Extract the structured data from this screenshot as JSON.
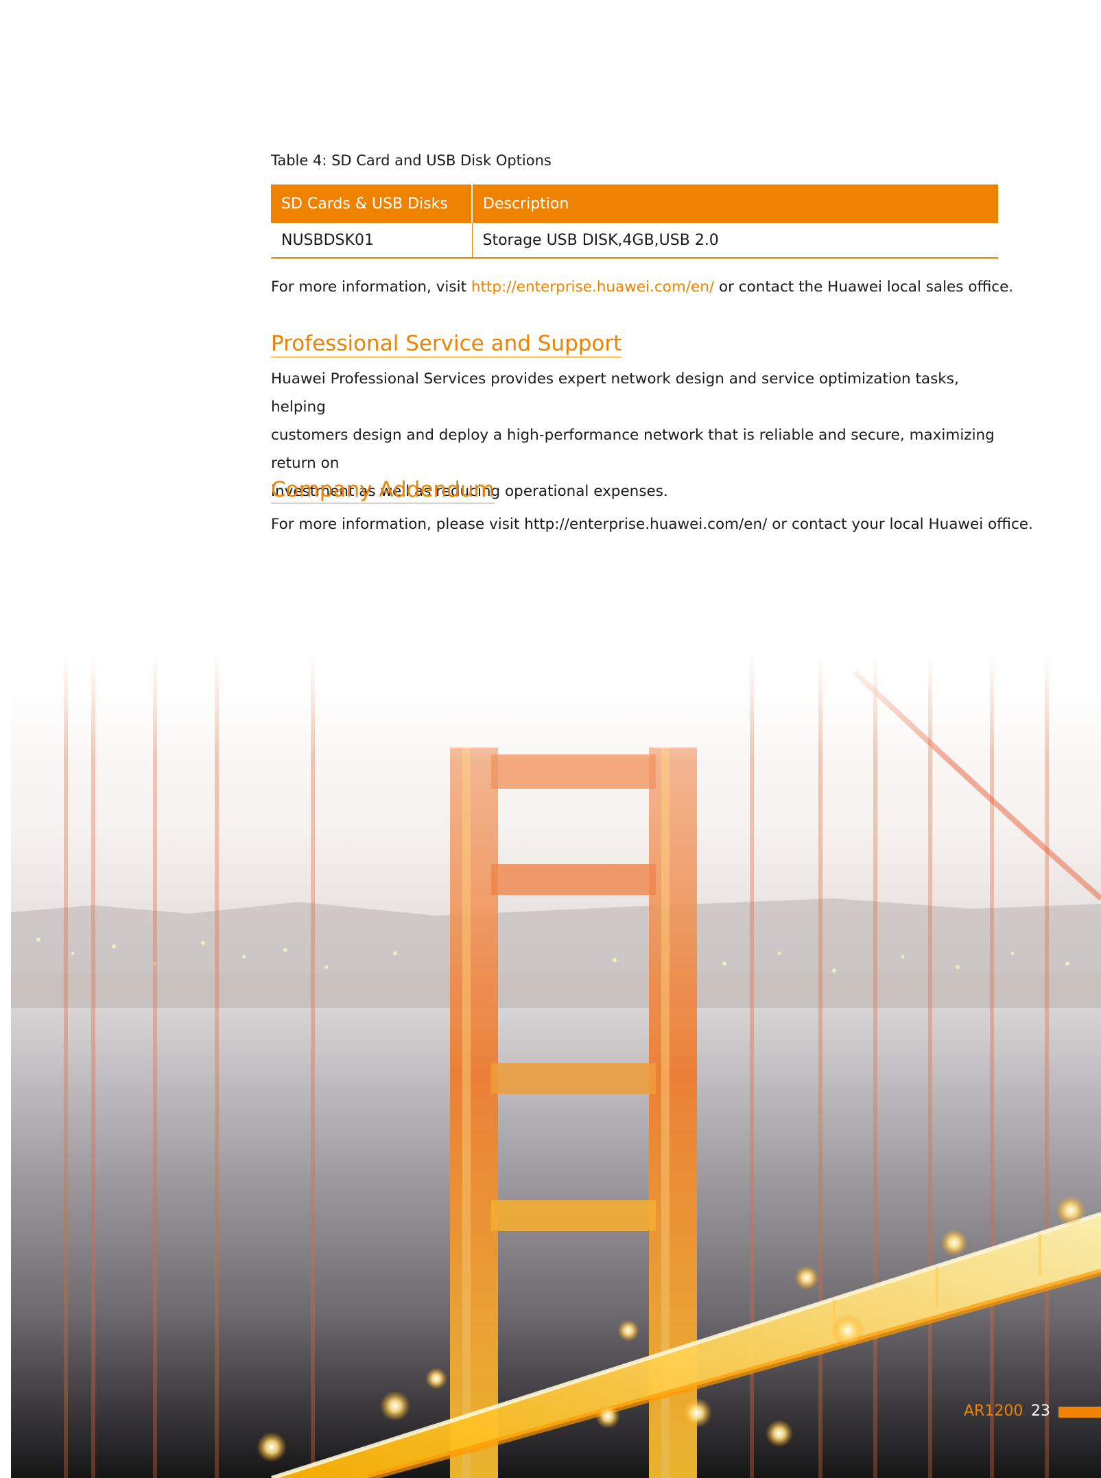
{
  "table": {
    "caption": "Table 4: SD Card and USB Disk Options",
    "headers": [
      "SD Cards & USB Disks",
      "Description"
    ],
    "rows": [
      [
        "NUSBDSK01",
        "Storage USB DISK,4GB,USB 2.0"
      ]
    ]
  },
  "info": {
    "prefix": "For more information, visit ",
    "link": "http://enterprise.huawei.com/en/",
    "suffix": " or contact the Huawei local sales office."
  },
  "sections": [
    {
      "heading": "Professional Service and Support",
      "body_lines": [
        "Huawei Professional Services provides expert network design and service optimization tasks, helping",
        "customers design and deploy a high-performance network that is reliable and secure, maximizing return on",
        "investment as well as reducing operational expenses."
      ]
    },
    {
      "heading": "Company Addendum",
      "body_lines": [
        "For more information, please visit http://enterprise.huawei.com/en/ or contact your local Huawei office."
      ]
    }
  ],
  "footer": {
    "model": "AR1200",
    "page": "23"
  },
  "colors": {
    "accent": "#ef8200"
  }
}
